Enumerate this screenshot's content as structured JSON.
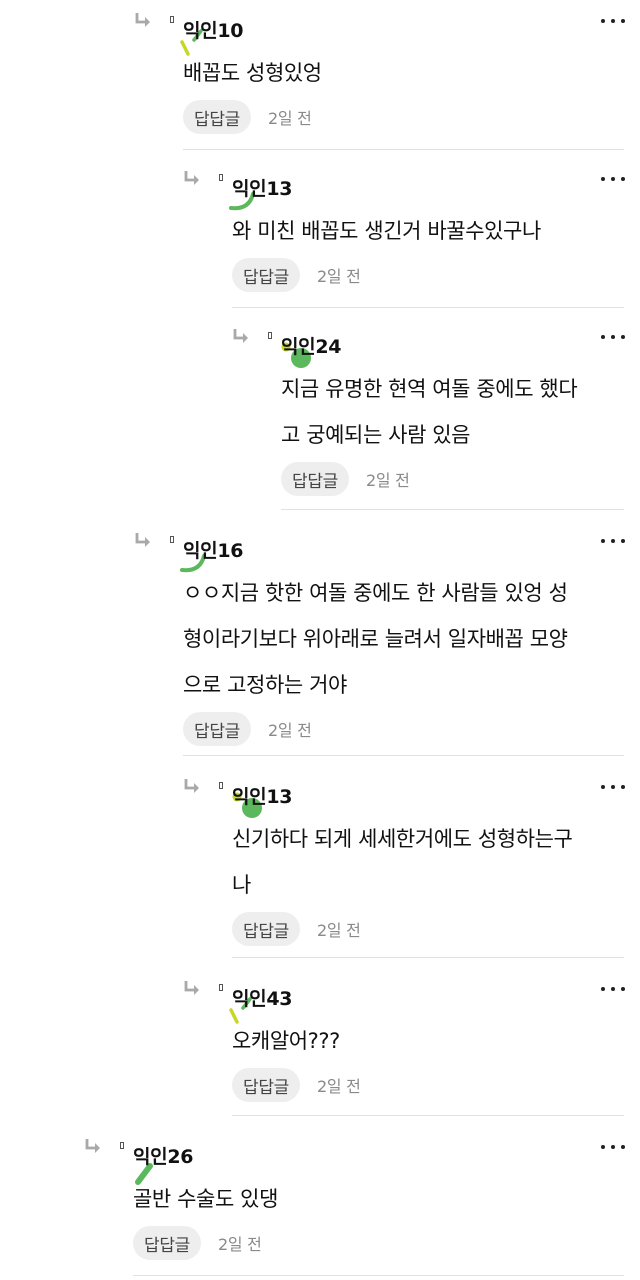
{
  "reply_button_label": "답답글",
  "comments": [
    {
      "author": "익인10",
      "lines": [
        "배꼽도 성형있엉"
      ],
      "time": "2일 전"
    },
    {
      "author": "익인13",
      "lines": [
        "와 미친 배꼽도 생긴거 바꿀수있구나"
      ],
      "time": "2일 전"
    },
    {
      "author": "익인24",
      "lines": [
        "지금 유명한 현역 여돌 중에도 했다",
        "고 궁예되는 사람 있음"
      ],
      "time": "2일 전"
    },
    {
      "author": "익인16",
      "lines": [
        "ㅇㅇ지금 핫한 여돌 중에도 한 사람들 있엉 성",
        "형이라기보다 위아래로 늘려서 일자배꼽 모양",
        "으로 고정하는 거야"
      ],
      "time": "2일 전"
    },
    {
      "author": "익인13",
      "lines": [
        "신기하다 되게 세세한거에도 성형하는구",
        "나"
      ],
      "time": "2일 전"
    },
    {
      "author": "익인43",
      "lines": [
        "오캐알어???"
      ],
      "time": "2일 전"
    },
    {
      "author": "익인26",
      "lines": [
        "골반 수술도 있댕"
      ],
      "time": "2일 전"
    }
  ],
  "colors": {
    "arrow": "#a9a9a9",
    "reply_button_bg": "#eeeeee",
    "avatar_green": "#5cb85c",
    "avatar_lime": "#c8d628",
    "divider": "#e2e2e2"
  }
}
